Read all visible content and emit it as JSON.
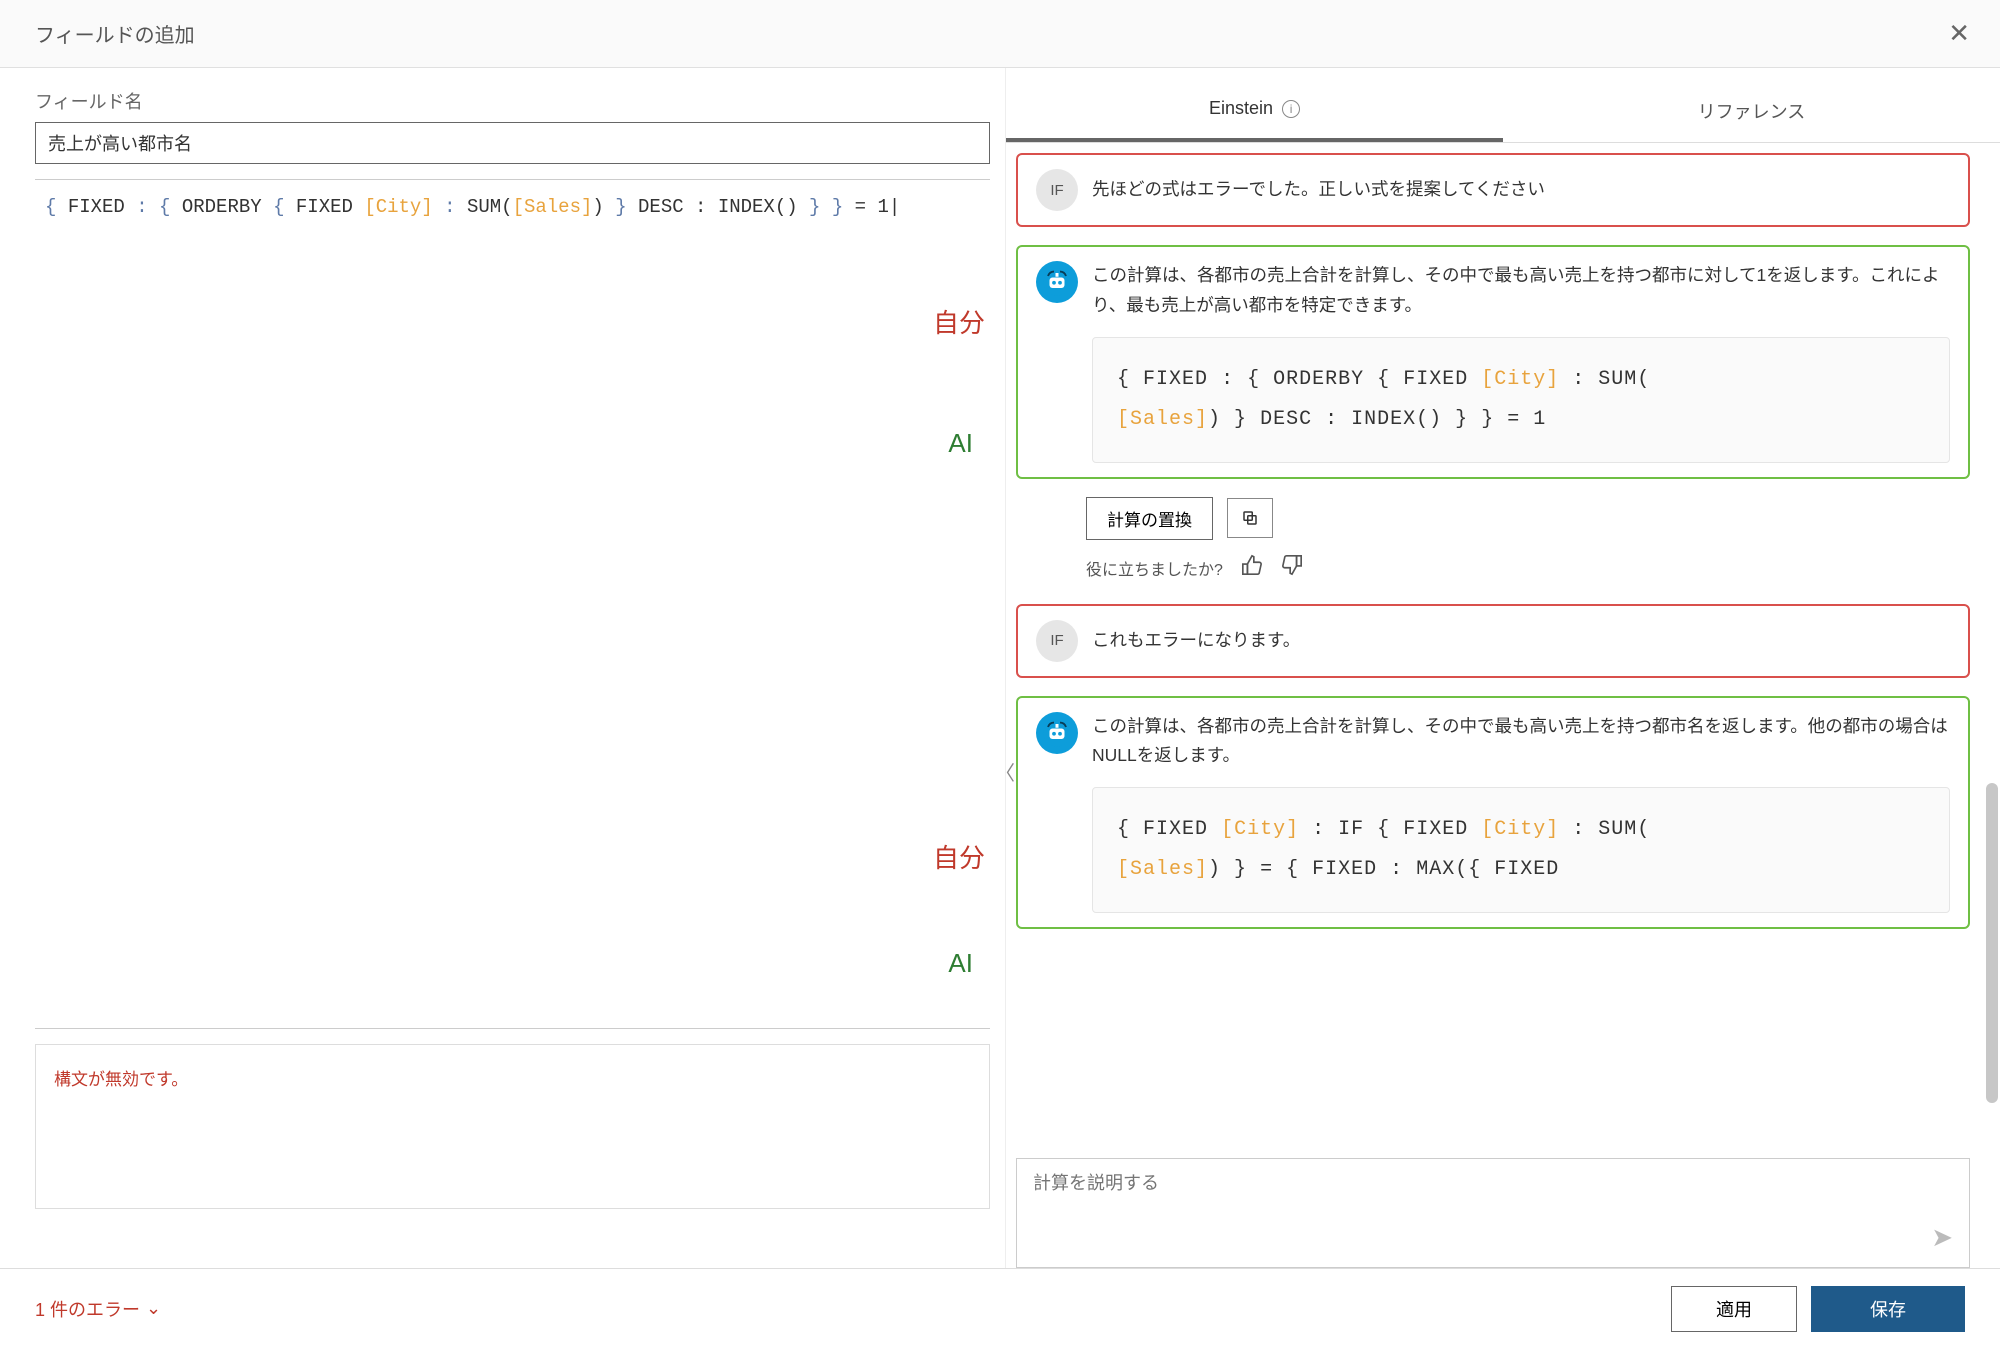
{
  "dialog": {
    "title": "フィールドの追加"
  },
  "left": {
    "field_name_label": "フィールド名",
    "field_name_value": "売上が高い都市名",
    "formula_tokens": [
      {
        "c": "tk-b",
        "t": "{ "
      },
      {
        "c": "tk-k",
        "t": "FIXED"
      },
      {
        "c": "tk-b",
        "t": " : { "
      },
      {
        "c": "tk-k",
        "t": "ORDERBY"
      },
      {
        "c": "tk-b",
        "t": " { "
      },
      {
        "c": "tk-k",
        "t": "FIXED"
      },
      {
        "c": "tk-b",
        "t": " "
      },
      {
        "c": "tk-o",
        "t": "[City]"
      },
      {
        "c": "tk-b",
        "t": " : "
      },
      {
        "c": "tk-k",
        "t": "SUM("
      },
      {
        "c": "tk-o",
        "t": "[Sales]"
      },
      {
        "c": "tk-k",
        "t": ")"
      },
      {
        "c": "tk-b",
        "t": " } "
      },
      {
        "c": "tk-k",
        "t": "DESC : INDEX()"
      },
      {
        "c": "tk-b",
        "t": " } }"
      },
      {
        "c": "tk-k",
        "t": " = 1"
      }
    ],
    "self_label": "自分",
    "ai_label": "AI",
    "error_text": "構文が無効です。"
  },
  "right": {
    "tabs": {
      "einstein": "Einstein",
      "reference": "リファレンス"
    },
    "chat": [
      {
        "role": "user",
        "avatar_text": "IF",
        "text": "先ほどの式はエラーでした。正しい式を提案してください"
      },
      {
        "role": "ai",
        "text": "この計算は、各都市の売上合計を計算し、その中で最も高い売上を持つ都市に対して1を返します。これにより、最も売上が高い都市を特定できます。",
        "code_tokens": [
          {
            "c": "tk-k",
            "t": "{ FIXED : { ORDERBY { FIXED "
          },
          {
            "c": "tk-o",
            "t": "[City]"
          },
          {
            "c": "tk-k",
            "t": " : SUM("
          },
          {
            "c": "tk-o",
            "t": "[Sales]"
          },
          {
            "c": "tk-k",
            "t": ") } DESC : INDEX() } } = 1"
          }
        ]
      },
      {
        "role": "user",
        "avatar_text": "IF",
        "text": "これもエラーになります。"
      },
      {
        "role": "ai",
        "text": "この計算は、各都市の売上合計を計算し、その中で最も高い売上を持つ都市名を返します。他の都市の場合はNULLを返します。",
        "code_tokens": [
          {
            "c": "tk-k",
            "t": "{ FIXED "
          },
          {
            "c": "tk-o",
            "t": "[City]"
          },
          {
            "c": "tk-k",
            "t": " : IF { FIXED "
          },
          {
            "c": "tk-o",
            "t": "[City]"
          },
          {
            "c": "tk-k",
            "t": " : SUM("
          },
          {
            "c": "tk-o",
            "t": "[Sales]"
          },
          {
            "c": "tk-k",
            "t": ") } = { FIXED : MAX({ FIXED"
          }
        ]
      }
    ],
    "actions": {
      "replace_calc": "計算の置換"
    },
    "feedback": {
      "label": "役に立ちましたか?"
    },
    "input_placeholder": "計算を説明する"
  },
  "footer": {
    "error_count_label": "1 件のエラー",
    "apply": "適用",
    "save": "保存"
  }
}
